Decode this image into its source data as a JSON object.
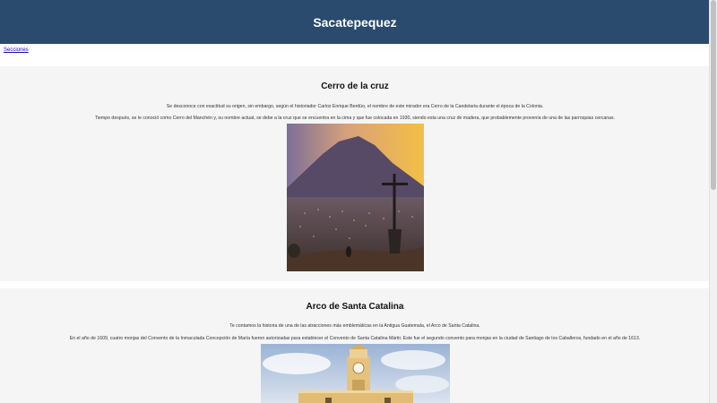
{
  "header": {
    "title": "Sacatepequez"
  },
  "nav": {
    "link_label": "Secciones"
  },
  "sections": [
    {
      "title": "Cerro de la cruz",
      "paragraphs": [
        "Se desconoce con exactitud su origen, sin embargo, según el historiador Carlos Enrique Berdúo, el nombre de este mirador era Cerro de la Candelaria durante el época de la Colonia.",
        "Tiempo después, se le conoció como Cerro del Manchén y, su nombre actual, se debe a la cruz que se encuentra en la cima y que fue colocada en 1930, siendo esta una cruz de madera, que probablemente provenía de una de las parroquias cercanas."
      ]
    },
    {
      "title": "Arco de Santa Catalina",
      "paragraphs": [
        "Te contamos la historia de una de las atracciones más emblemáticas en la Antigua Guatemala, el Arco de Santa Catalina.",
        "En el año de 1609, cuatro monjas del Convento de la Inmaculada Concepción de María fueron autorizadas para establecer el Convento de Santa Catalina Mártir. Este fue el segundo convento para monjas en la ciudad de Santiago de los Caballeros, fundado en el año de 1613."
      ]
    }
  ],
  "colors": {
    "header_bg": "#2a4a6e",
    "section_bg": "#f5f5f5",
    "link": "#1a0dab"
  }
}
